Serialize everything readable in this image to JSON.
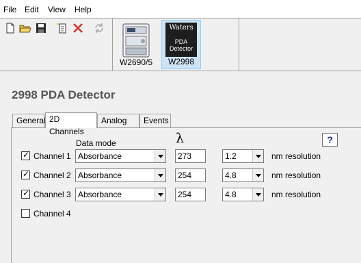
{
  "menu": {
    "file": "File",
    "edit": "Edit",
    "view": "View",
    "help": "Help"
  },
  "toolbar": {
    "icons": [
      "new-document-icon",
      "open-folder-icon",
      "save-icon",
      "properties-icon",
      "delete-icon",
      "refresh-icon"
    ]
  },
  "devices": [
    {
      "label": "W2690/5",
      "selected": false
    },
    {
      "label": "W2998",
      "selected": true,
      "logo_text": [
        "Waters",
        "PDA",
        "Detector"
      ]
    }
  ],
  "page": {
    "title": "2998 PDA Detector"
  },
  "tabs": [
    "General",
    "2D Channels",
    "Analog Out",
    "Events"
  ],
  "active_tab": "2D Channels",
  "help_label": "?",
  "columns": {
    "data_mode": "Data mode",
    "wavelength_symbol": "λ"
  },
  "channels": [
    {
      "label": "Channel 1",
      "checked": true,
      "data_mode": "Absorbance",
      "wavelength": "273",
      "resolution": "1.2",
      "unit": "nm resolution"
    },
    {
      "label": "Channel 2",
      "checked": true,
      "data_mode": "Absorbance",
      "wavelength": "254",
      "resolution": "4.8",
      "unit": "nm resolution"
    },
    {
      "label": "Channel 3",
      "checked": true,
      "data_mode": "Absorbance",
      "wavelength": "254",
      "resolution": "4.8",
      "unit": "nm resolution"
    },
    {
      "label": "Channel 4",
      "checked": false
    }
  ],
  "colors": {
    "title": "#555555",
    "selected_bg": "#cde4f7",
    "help_text": "#1a2a8a",
    "delete_red": "#d03030"
  }
}
